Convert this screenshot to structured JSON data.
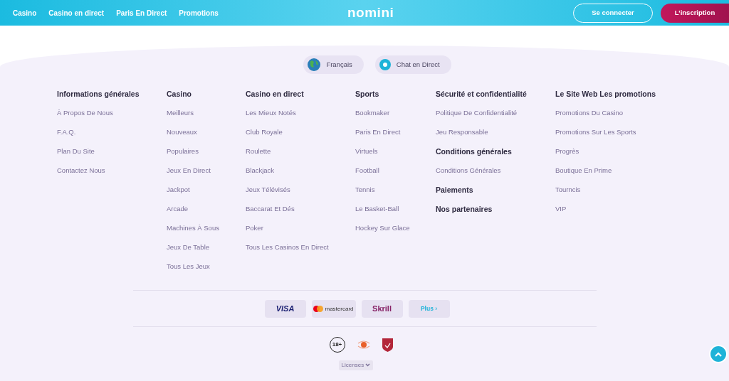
{
  "header": {
    "nav": [
      "Casino",
      "Casino en direct",
      "Paris En Direct",
      "Promotions"
    ],
    "logo": "nomini",
    "login": "Se connecter",
    "signup": "L’inscription"
  },
  "pills": [
    {
      "kind": "globe",
      "label": "Français"
    },
    {
      "kind": "chat",
      "label": "Chat en Direct"
    }
  ],
  "columns": [
    {
      "items": [
        {
          "kind": "heading",
          "text": "Informations générales"
        },
        {
          "kind": "link",
          "text": "À Propos De Nous"
        },
        {
          "kind": "link",
          "text": "F.A.Q."
        },
        {
          "kind": "link",
          "text": "Plan Du Site"
        },
        {
          "kind": "link",
          "text": "Contactez Nous"
        }
      ]
    },
    {
      "items": [
        {
          "kind": "heading",
          "text": "Casino"
        },
        {
          "kind": "link",
          "text": "Meilleurs"
        },
        {
          "kind": "link",
          "text": "Nouveaux"
        },
        {
          "kind": "link",
          "text": "Populaires"
        },
        {
          "kind": "link",
          "text": "Jeux En Direct"
        },
        {
          "kind": "link",
          "text": "Jackpot"
        },
        {
          "kind": "link",
          "text": "Arcade"
        },
        {
          "kind": "link",
          "text": "Machines À Sous"
        },
        {
          "kind": "link",
          "text": "Jeux De Table"
        },
        {
          "kind": "link",
          "text": "Tous Les Jeux"
        }
      ]
    },
    {
      "items": [
        {
          "kind": "heading",
          "text": "Casino en direct"
        },
        {
          "kind": "link",
          "text": "Les Mieux Notés"
        },
        {
          "kind": "link",
          "text": "Club Royale"
        },
        {
          "kind": "link",
          "text": "Roulette"
        },
        {
          "kind": "link",
          "text": "Blackjack"
        },
        {
          "kind": "link",
          "text": "Jeux Télévisés"
        },
        {
          "kind": "link",
          "text": "Baccarat Et Dés"
        },
        {
          "kind": "link",
          "text": "Poker"
        },
        {
          "kind": "link",
          "text": "Tous Les Casinos En Direct"
        }
      ]
    },
    {
      "items": [
        {
          "kind": "heading",
          "text": "Sports"
        },
        {
          "kind": "link",
          "text": "Bookmaker"
        },
        {
          "kind": "link",
          "text": "Paris En Direct"
        },
        {
          "kind": "link",
          "text": "Virtuels"
        },
        {
          "kind": "link",
          "text": "Football"
        },
        {
          "kind": "link",
          "text": "Tennis"
        },
        {
          "kind": "link",
          "text": "Le Basket-Ball"
        },
        {
          "kind": "link",
          "text": "Hockey Sur Glace"
        }
      ]
    },
    {
      "items": [
        {
          "kind": "heading",
          "text": "Sécurité et confidentialité"
        },
        {
          "kind": "link",
          "text": "Politique De Confidentialité"
        },
        {
          "kind": "link",
          "text": "Jeu Responsable"
        },
        {
          "kind": "heading",
          "text": "Conditions générales"
        },
        {
          "kind": "link",
          "text": "Conditions Générales"
        },
        {
          "kind": "heading",
          "text": "Paiements"
        },
        {
          "kind": "heading",
          "text": "Nos partenaires"
        }
      ]
    },
    {
      "items": [
        {
          "kind": "heading",
          "text": "Le Site Web Les promotions"
        },
        {
          "kind": "link",
          "text": "Promotions Du Casino"
        },
        {
          "kind": "link",
          "text": "Promotions Sur Les Sports"
        },
        {
          "kind": "link",
          "text": "Progrès"
        },
        {
          "kind": "link",
          "text": "Boutique En Prime"
        },
        {
          "kind": "link",
          "text": "Tourncis"
        },
        {
          "kind": "link",
          "text": "VIP"
        }
      ]
    }
  ],
  "payments": [
    {
      "kind": "visa",
      "label": "VISA"
    },
    {
      "kind": "mastercard",
      "label": "mastercard"
    },
    {
      "kind": "skrill",
      "label": "Skrill"
    },
    {
      "kind": "more",
      "label": "Plus ›"
    }
  ],
  "badges": [
    {
      "kind": "age",
      "label": "18+"
    },
    {
      "kind": "seal"
    },
    {
      "kind": "shield"
    }
  ],
  "licenses": "Licenses"
}
